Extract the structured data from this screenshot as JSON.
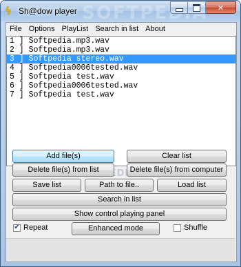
{
  "window": {
    "title": "Sh@dow player",
    "watermark": "SOFTPEDIA",
    "icon": "lightning-icon",
    "close_glyph": "✕"
  },
  "menu": [
    "File",
    "Options",
    "PlayList",
    "Search in list",
    "About"
  ],
  "playlist": [
    {
      "text": "1 ] Softpedia.mp3.wav",
      "selected": false
    },
    {
      "text": "2 ] Softpedia.mp3.wav",
      "selected": false
    },
    {
      "text": "3 ] Softpedia stereo.wav",
      "selected": true
    },
    {
      "text": "4 ] Softpedia0006tested.wav",
      "selected": false
    },
    {
      "text": "5 ] Softpedia test.wav",
      "selected": false
    },
    {
      "text": "6 ] Softpedia0006tested.wav",
      "selected": false
    },
    {
      "text": "7 ] Softpedia test.wav",
      "selected": false
    }
  ],
  "buttons": {
    "add": "Add file(s)",
    "clear": "Clear list",
    "delete_list": "Delete file(s) from list",
    "delete_computer": "Delete file(s) from computer",
    "save": "Save list",
    "path": "Path to file..",
    "load": "Load list",
    "search": "Search in list",
    "control_panel": "Show control playing panel",
    "enhanced": "Enhanced mode"
  },
  "button_watermark": "SOFTPEDIA",
  "options": {
    "repeat_label": "Repeat",
    "repeat_checked": true,
    "shuffle_label": "Shuffle",
    "shuffle_checked": false
  }
}
